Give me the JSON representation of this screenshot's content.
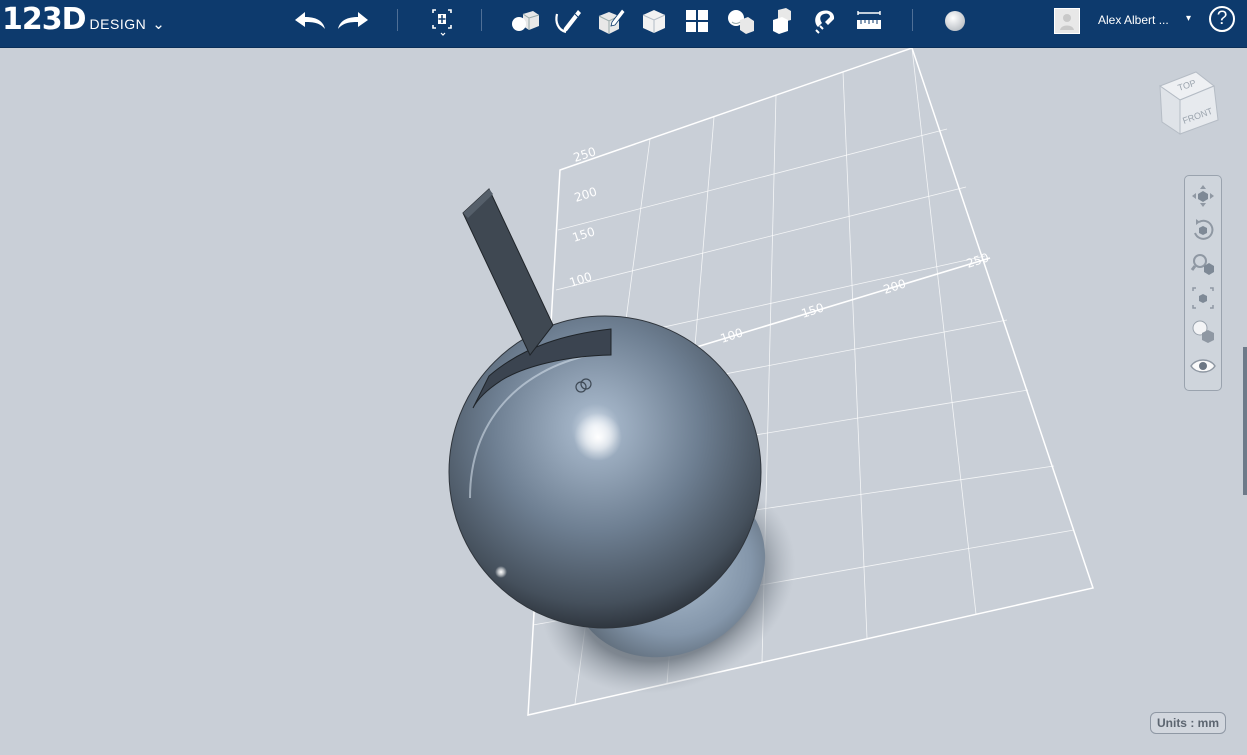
{
  "app": {
    "logo_number": "123D",
    "logo_word": "DESIGN",
    "logo_menu_glyph": "⌄"
  },
  "toolbar": {
    "tools": [
      {
        "name": "undo-icon"
      },
      {
        "name": "redo-icon"
      },
      {
        "name": "transform-icon"
      },
      {
        "name": "primitives-icon"
      },
      {
        "name": "sketch-icon"
      },
      {
        "name": "construct-icon"
      },
      {
        "name": "modify-icon"
      },
      {
        "name": "pattern-icon"
      },
      {
        "name": "grouping-icon"
      },
      {
        "name": "combine-icon"
      },
      {
        "name": "snap-icon"
      },
      {
        "name": "measure-icon"
      },
      {
        "name": "material-icon"
      }
    ]
  },
  "user": {
    "name": "Alex Albert  ...",
    "caret": "▾"
  },
  "help": {
    "label": "?"
  },
  "grid": {
    "y_ticks": [
      "250",
      "200",
      "150",
      "100"
    ],
    "x_ticks": [
      "100",
      "150",
      "200",
      "250"
    ]
  },
  "viewcube": {
    "top_label": "TOP",
    "front_label": "FRONT"
  },
  "nav": {
    "items": [
      {
        "name": "pan-icon"
      },
      {
        "name": "orbit-icon"
      },
      {
        "name": "zoom-icon"
      },
      {
        "name": "fit-icon"
      },
      {
        "name": "view-material-icon"
      },
      {
        "name": "visibility-eye-icon"
      }
    ]
  },
  "units": {
    "label": "Units : mm"
  },
  "colors": {
    "toolbar": "#0d3a6d",
    "canvas": "#c9cfd7",
    "sphere": "#6f7f91"
  }
}
